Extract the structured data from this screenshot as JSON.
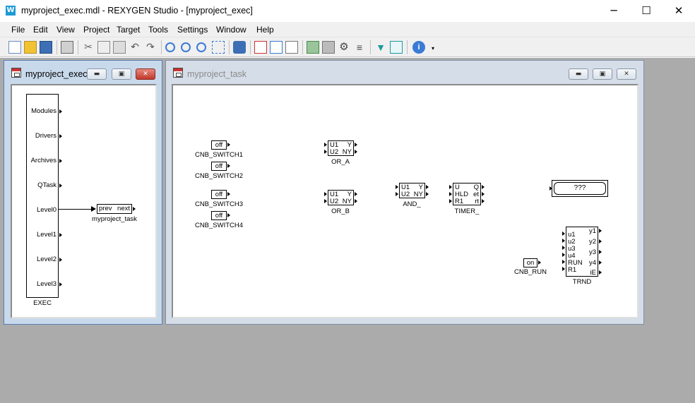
{
  "window": {
    "title": "myproject_exec.mdl - REXYGEN Studio - [myproject_exec]",
    "app_icon_text": "W",
    "minimize": "─",
    "maximize": "☐",
    "close": "✕"
  },
  "menu": [
    "File",
    "Edit",
    "View",
    "Project",
    "Target",
    "Tools",
    "Settings",
    "Window",
    "Help"
  ],
  "toolbar": {
    "icons": [
      "new-file-icon",
      "open-folder-icon",
      "save-icon",
      "print-icon",
      "cut-icon",
      "copy-icon",
      "paste-icon",
      "undo-icon",
      "redo-icon",
      "zoom-in-icon",
      "zoom-out-icon",
      "zoom-fit-icon",
      "select-all-icon",
      "compile-icon",
      "export-icon",
      "download-icon",
      "preview-icon",
      "connect-icon",
      "disconnect-icon",
      "settings-gear-icon",
      "list-icon",
      "watch-icon",
      "trend-icon",
      "info-icon"
    ]
  },
  "exec_window": {
    "title": "myproject_exec",
    "block_name": "EXEC",
    "ports": [
      "Modules",
      "Drivers",
      "Archives",
      "QTask",
      "Level0",
      "Level1",
      "Level2",
      "Level3"
    ],
    "task_block": {
      "in_label": "prev",
      "out_label": "next",
      "name": "myproject_task"
    }
  },
  "task_window": {
    "title": "myproject_task",
    "switches": [
      {
        "value": "off",
        "name": "CNB_SWITCH1"
      },
      {
        "value": "off",
        "name": "CNB_SWITCH2"
      },
      {
        "value": "off",
        "name": "CNB_SWITCH3"
      },
      {
        "value": "off",
        "name": "CNB_SWITCH4"
      }
    ],
    "or_a": {
      "name": "OR_A",
      "in1": "U1",
      "in2": "U2",
      "out1": "Y",
      "out2": "NY"
    },
    "or_b": {
      "name": "OR_B",
      "in1": "U1",
      "in2": "U2",
      "out1": "Y",
      "out2": "NY"
    },
    "and": {
      "name": "AND_",
      "in1": "U1",
      "in2": "U2",
      "out1": "Y",
      "out2": "NY"
    },
    "timer": {
      "name": "TIMER_",
      "in1": "U",
      "in2": "HLD",
      "in3": "R1",
      "out1": "Q",
      "out2": "et",
      "out3": "rt"
    },
    "display": {
      "value": "???"
    },
    "run_switch": {
      "value": "on",
      "name": "CNB_RUN"
    },
    "trnd": {
      "name": "TRND",
      "inputs": [
        "u1",
        "u2",
        "u3",
        "u4",
        "RUN",
        "R1"
      ],
      "outputs": [
        "y1",
        "y2",
        "y3",
        "y4",
        "iE"
      ]
    }
  }
}
